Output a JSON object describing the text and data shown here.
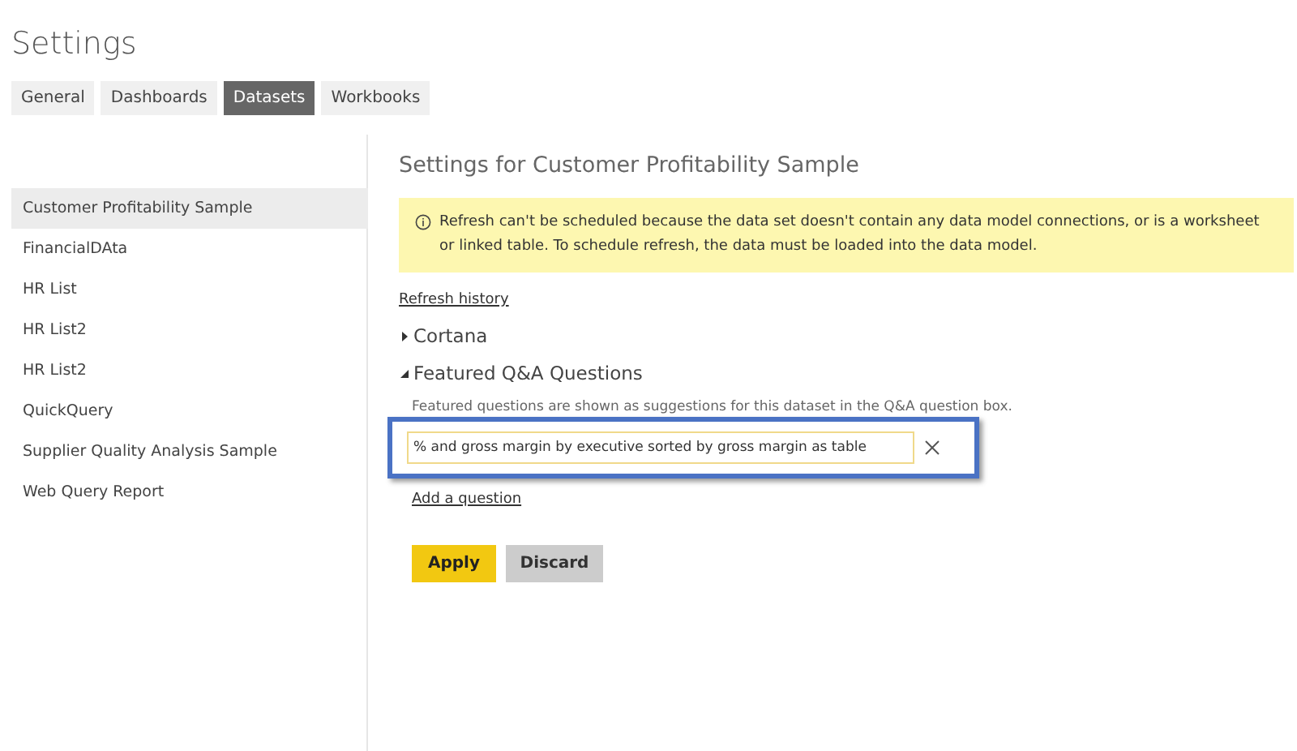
{
  "title": "Settings",
  "tabs": [
    {
      "label": "General",
      "selected": false
    },
    {
      "label": "Dashboards",
      "selected": false
    },
    {
      "label": "Datasets",
      "selected": true
    },
    {
      "label": "Workbooks",
      "selected": false
    }
  ],
  "datasets": [
    {
      "label": "Customer Profitability Sample",
      "selected": true
    },
    {
      "label": "FinancialDAta",
      "selected": false
    },
    {
      "label": "HR List",
      "selected": false
    },
    {
      "label": "HR List2",
      "selected": false
    },
    {
      "label": "HR List2",
      "selected": false
    },
    {
      "label": "QuickQuery",
      "selected": false
    },
    {
      "label": "Supplier Quality Analysis Sample",
      "selected": false
    },
    {
      "label": "Web Query Report",
      "selected": false
    }
  ],
  "heading": "Settings for Customer Profitability Sample",
  "warning": "Refresh can't be scheduled because the data set doesn't contain any data model connections, or is a worksheet or linked table. To schedule refresh, the data must be loaded into the data model.",
  "refresh_link": "Refresh history",
  "sections": [
    {
      "label": "Cortana",
      "expanded": false
    },
    {
      "label": "Featured Q&A Questions",
      "expanded": true
    }
  ],
  "qa": {
    "description": "Featured questions are shown as suggestions for this dataset in the Q&A question box.",
    "question": "% and gross margin by executive sorted by gross margin as table",
    "add_link": "Add a question"
  },
  "buttons": [
    {
      "label": "Apply",
      "kind": "primary"
    },
    {
      "label": "Discard",
      "kind": "secondary"
    }
  ]
}
